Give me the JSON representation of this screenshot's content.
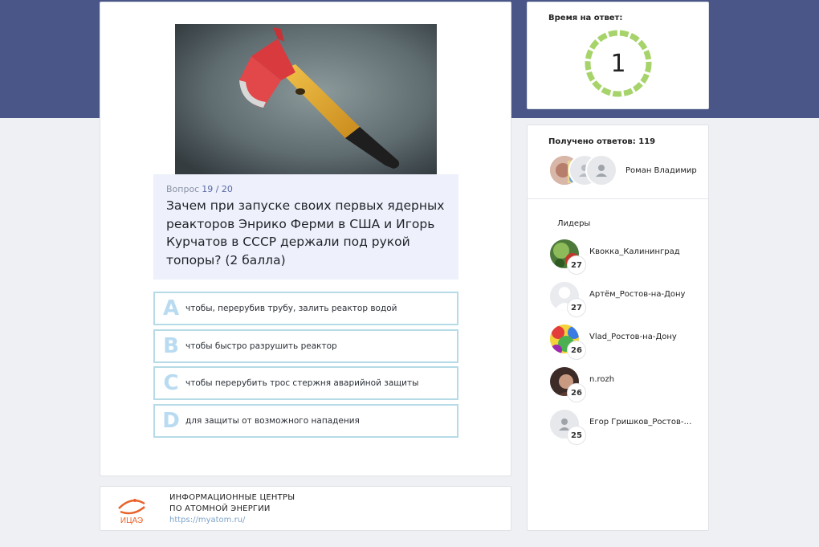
{
  "timer": {
    "label": "Время на ответ:",
    "value": "1",
    "ring_color": "#a6d36a"
  },
  "question": {
    "label": "Вопрос",
    "number": "19 / 20",
    "text": "Зачем при запуске своих первых ядерных реакторов Энрико Ферми в США и Игорь Курчатов в СССР держали под рукой топоры? (2 балла)",
    "image_subject": "fire-axe-image"
  },
  "answers": [
    {
      "letter": "A",
      "text": "чтобы, перерубив трубу, залить реактор водой"
    },
    {
      "letter": "B",
      "text": "чтобы быстро разрушить реактор"
    },
    {
      "letter": "C",
      "text": "чтобы перерубить трос стержня аварийной защиты"
    },
    {
      "letter": "D",
      "text": "для защиты от возможного нападения"
    }
  ],
  "responses": {
    "label": "Получено ответов: 119",
    "latest_name": "Роман Владимир"
  },
  "leaders": {
    "title": "Лидеры",
    "items": [
      {
        "name": "Квокка_Калининград",
        "score": "27"
      },
      {
        "name": "Артём_Ростов-на-Дону",
        "score": "27"
      },
      {
        "name": "Vlad_Ростов-на-Дону",
        "score": "26"
      },
      {
        "name": "n.rozh",
        "score": "26"
      },
      {
        "name": "Егор Гришков_Ростов-на-Дону",
        "score": "25"
      }
    ]
  },
  "footer": {
    "logo_text": "ИЦАЭ",
    "line1": "ИНФОРМАЦИОННЫЕ ЦЕНТРЫ",
    "line2": "ПО АТОМНОЙ ЭНЕРГИИ",
    "url": "https://myatom.ru/"
  },
  "colors": {
    "header_band": "#4a5688",
    "answer_border": "#b6dbe6",
    "answer_letter": "#b9dbf1",
    "question_bg": "#eef0fb",
    "brand_orange": "#e8632a"
  }
}
